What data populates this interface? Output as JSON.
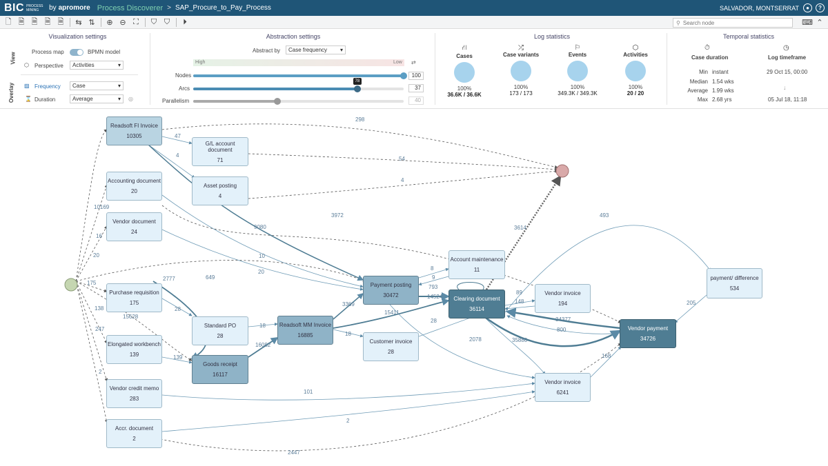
{
  "topbar": {
    "logo_bic": "BIC",
    "logo_sub": "PROCESS MINING",
    "logo_by": "by",
    "logo_vendor": "apromore",
    "app": "Process Discoverer",
    "sep": ">",
    "process": "SAP_Procure_to_Pay_Process",
    "user": "SALVADOR, MONTSERRAT"
  },
  "search": {
    "placeholder": "Search node"
  },
  "viz": {
    "title": "Visualization settings",
    "view_label": "View",
    "overlay_label": "Overlay",
    "process_map": "Process map",
    "bpmn": "BPMN model",
    "perspective_label": "Perspective",
    "perspective_value": "Activities",
    "frequency_label": "Frequency",
    "frequency_value": "Case",
    "duration_label": "Duration",
    "duration_value": "Average"
  },
  "abstraction": {
    "title": "Abstraction settings",
    "abstract_by_label": "Abstract by",
    "abstract_by_value": "Case frequency",
    "high": "High",
    "low": "Low",
    "nodes_label": "Nodes",
    "nodes_value": "100",
    "nodes_fraction": 1.0,
    "arcs_label": "Arcs",
    "arcs_value": "37",
    "arcs_tip": "78",
    "arcs_fraction": 0.78,
    "parallelism_label": "Parallelism",
    "parallelism_value": "40",
    "parallelism_fraction": 0.4
  },
  "log_stats": {
    "title": "Log statistics",
    "items": [
      {
        "label": "Cases",
        "pct": "100%",
        "value": "36.6K / 36.6K"
      },
      {
        "label": "Case variants",
        "pct": "100%",
        "value": "173 / 173"
      },
      {
        "label": "Events",
        "pct": "100%",
        "value": "349.3K / 349.3K"
      },
      {
        "label": "Activities",
        "pct": "100%",
        "value": "20 / 20"
      }
    ]
  },
  "temporal": {
    "title": "Temporal statistics",
    "case_duration": "Case duration",
    "log_timeframe": "Log timeframe",
    "rows": [
      {
        "k": "Min",
        "v": "instant"
      },
      {
        "k": "Median",
        "v": "1.54 wks"
      },
      {
        "k": "Average",
        "v": "1.99 wks"
      },
      {
        "k": "Max",
        "v": "2.68 yrs"
      }
    ],
    "start": "29 Oct 15, 00:00",
    "end": "05 Jul 18, 11:18"
  },
  "nodes": [
    {
      "name": "Readsoft FI Invoice",
      "count": "10305"
    },
    {
      "name": "G/L account document",
      "count": "71"
    },
    {
      "name": "Accounting document",
      "count": "20"
    },
    {
      "name": "Asset posting",
      "count": "4"
    },
    {
      "name": "Vendor document",
      "count": "24"
    },
    {
      "name": "Purchase requisition",
      "count": "175"
    },
    {
      "name": "Standard PO",
      "count": "28"
    },
    {
      "name": "Readsoft MM Invoice",
      "count": "16885"
    },
    {
      "name": "Elongated workbench",
      "count": "139"
    },
    {
      "name": "Goods receipt",
      "count": "16117"
    },
    {
      "name": "Vendor credit memo",
      "count": "283"
    },
    {
      "name": "Accr. document",
      "count": "2"
    },
    {
      "name": "Payment posting",
      "count": "30472"
    },
    {
      "name": "Customer invoice",
      "count": "28"
    },
    {
      "name": "Account maintenance",
      "count": "11"
    },
    {
      "name": "Clearing document",
      "count": "36114"
    },
    {
      "name": "Vendor invoice",
      "count": "194"
    },
    {
      "name": "Vendor payment",
      "count": "34726"
    },
    {
      "name": "Vendor invoice",
      "count": "6241"
    },
    {
      "name": "payment/ difference",
      "count": "534"
    }
  ],
  "edges": [
    "298",
    "47",
    "4",
    "54",
    "4",
    "10169",
    "16",
    "20",
    "175",
    "2777",
    "649",
    "3972",
    "10",
    "20",
    "9080",
    "3614",
    "493",
    "8",
    "9",
    "793",
    "14524",
    "3369",
    "15411",
    "18",
    "16082",
    "28",
    "138",
    "18",
    "28",
    "89",
    "148",
    "34377",
    "800",
    "205",
    "2078",
    "35880",
    "168",
    "101",
    "2",
    "2447",
    "139",
    "15628",
    "247",
    "2"
  ]
}
